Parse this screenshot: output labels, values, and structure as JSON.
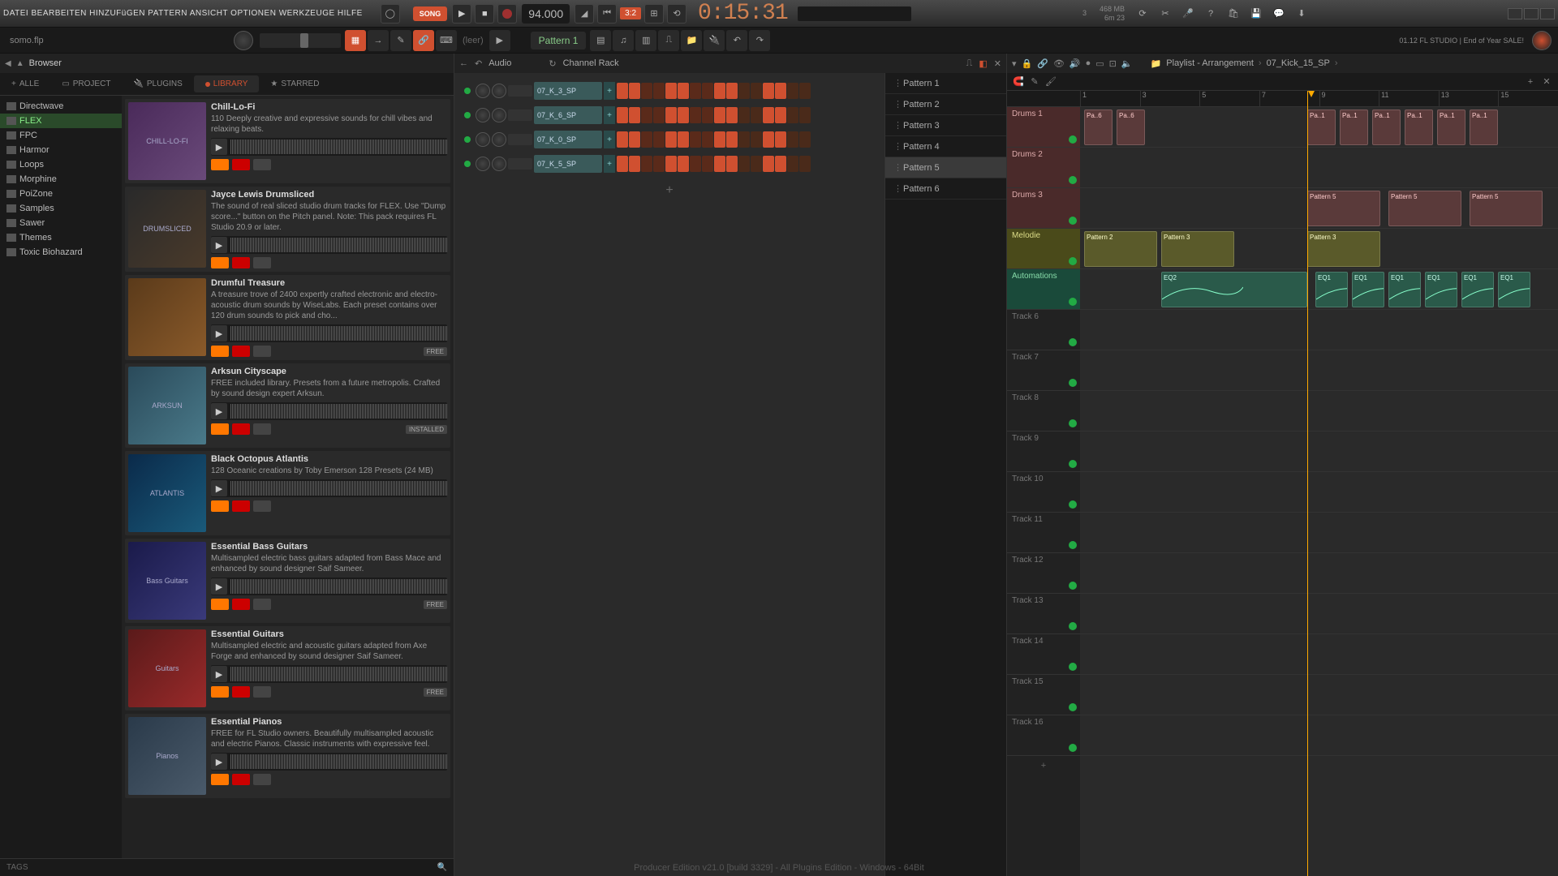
{
  "menu": {
    "items": "DATEI BEARBEITEN HINZUFüGEN PATTERN ANSICHT OPTIONEN WERKZEUGE HILFE"
  },
  "transport": {
    "mode": "SONG",
    "tempo": "94.000",
    "snap": "3:2",
    "time": "0:15:31",
    "voices": "3",
    "mem": "468 MB",
    "memtime": "6m 23"
  },
  "hint": "somo.flp",
  "pattern_selector": "Pattern 1",
  "leer": "(leer)",
  "promo": "01.12 FL STUDIO | End of Year SALE!",
  "browser": {
    "title": "Browser",
    "tabs": {
      "all": "ALLE",
      "project": "PROJECT",
      "plugins": "PLUGINS",
      "library": "LIBRARY",
      "starred": "STARRED"
    },
    "tree": [
      "Directwave",
      "FLEX",
      "FPC",
      "Harmor",
      "Loops",
      "Morphine",
      "PoiZone",
      "Samples",
      "Sawer",
      "Themes",
      "Toxic Biohazard"
    ],
    "tree_active": 1,
    "tags": "TAGS"
  },
  "packs": [
    {
      "title": "Chill-Lo-Fi",
      "desc": "110 Deeply creative and expressive sounds for chill vibes and relaxing beats.",
      "thumb": "CHILL-LO-FI",
      "thumbcls": "thumb-chill",
      "badge": ""
    },
    {
      "title": "Jayce Lewis Drumsliced",
      "desc": "The sound of real sliced studio drum tracks for FLEX. Use \"Dump score...\" button on the Pitch panel. Note: This pack requires FL Studio 20.9 or later.",
      "thumb": "DRUMSLICED",
      "thumbcls": "thumb-drums",
      "badge": ""
    },
    {
      "title": "Drumful Treasure",
      "desc": "A treasure trove of 2400 expertly crafted electronic and electro-acoustic drum sounds by WiseLabs. Each preset contains over 120 drum sounds to pick and cho...",
      "thumb": "",
      "thumbcls": "thumb-treasure",
      "badge": "FREE"
    },
    {
      "title": "Arksun Cityscape",
      "desc": "FREE included library. Presets from a future metropolis. Crafted by sound design expert Arksun.",
      "thumb": "ARKSUN",
      "thumbcls": "thumb-city",
      "badge": "INSTALLED"
    },
    {
      "title": "Black Octopus Atlantis",
      "desc": "128 Oceanic creations by Toby Emerson 128 Presets (24 MB)",
      "thumb": "ATLANTIS",
      "thumbcls": "thumb-atlantis",
      "badge": ""
    },
    {
      "title": "Essential Bass Guitars",
      "desc": "Multisampled electric bass guitars adapted from Bass Mace and enhanced by sound designer Saif Sameer.",
      "thumb": "Bass Guitars",
      "thumbcls": "thumb-bass",
      "badge": "FREE"
    },
    {
      "title": "Essential Guitars",
      "desc": "Multisampled electric and acoustic guitars adapted from Axe Forge and enhanced by sound designer Saif Sameer.",
      "thumb": "Guitars",
      "thumbcls": "thumb-guitar",
      "badge": "FREE"
    },
    {
      "title": "Essential Pianos",
      "desc": "FREE for FL Studio owners. Beautifully multisampled acoustic and electric Pianos. Classic instruments with expressive feel.",
      "thumb": "Pianos",
      "thumbcls": "thumb-piano",
      "badge": ""
    }
  ],
  "rack": {
    "audio": "Audio",
    "title": "Channel Rack",
    "channels": [
      "07_K_3_SP",
      "07_K_6_SP",
      "07_K_0_SP",
      "07_K_5_SP"
    ],
    "add": "+"
  },
  "patterns": [
    "Pattern 1",
    "Pattern 2",
    "Pattern 3",
    "Pattern 4",
    "Pattern 5",
    "Pattern 6"
  ],
  "pattern_sel_idx": 4,
  "playlist": {
    "title": "Playlist - Arrangement",
    "clip": "07_Kick_15_SP",
    "ruler": [
      "1",
      "3",
      "5",
      "7",
      "9",
      "11",
      "13",
      "15"
    ],
    "tracks": [
      "Drums 1",
      "Drums 2",
      "Drums 3",
      "Melodie",
      "Automations",
      "Track 6",
      "Track 7",
      "Track 8",
      "Track 9",
      "Track 10",
      "Track 11",
      "Track 12",
      "Track 13",
      "Track 14",
      "Track 15",
      "Track 16"
    ],
    "clips": {
      "d1": [
        "Pa..6",
        "Pa..6",
        "Pa..1",
        "Pa..1",
        "Pa..1",
        "Pa..1",
        "Pa..1",
        "Pa..1"
      ],
      "d3": [
        "Pattern 5",
        "Pattern 5",
        "Pattern 5"
      ],
      "mel": [
        "Pattern 2",
        "Pattern 3",
        "Pattern 3"
      ],
      "auto": [
        "EQ2",
        "EQ1",
        "EQ1",
        "EQ1",
        "EQ1",
        "EQ1",
        "EQ1"
      ]
    },
    "add_track": "+"
  },
  "footer": "Producer Edition v21.0 [build 3329] - All Plugins Edition - Windows - 64Bit"
}
